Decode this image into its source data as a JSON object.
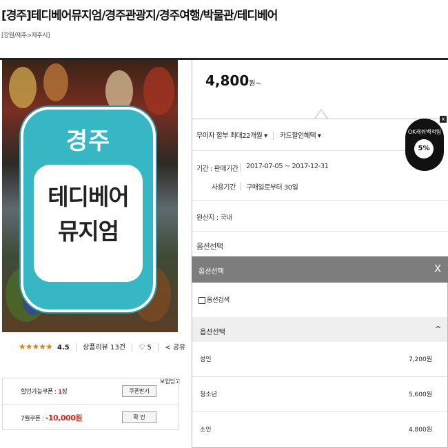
{
  "header": {
    "title": "[경주]테디베어뮤지엄/경주관광지/경주여행/박물관/테디베어",
    "breadcrumb": "[강원/제주>제주시]"
  },
  "hero": {
    "city": "경주",
    "line1": "테디베어",
    "line2": "뮤지엄"
  },
  "rating": {
    "stars": "★★★★★",
    "score": "4.5",
    "reviews_label": "상품리뷰 13건",
    "like_icon": "heart-icon",
    "likes": "5",
    "share_label": "공유"
  },
  "coupons": {
    "row1_label": "할인가능쿠폰 : ",
    "row1_count": "1",
    "row1_unit": "장",
    "row1_button": "쿠폰받기",
    "row2_label": "7월쿠폰 : ",
    "row2_value": "-10,000원",
    "row2_button": "확  인",
    "side_label": "보험담고"
  },
  "product": {
    "price": "4,800",
    "price_unit": "원~",
    "installment": "무이자 할부 최대22개월",
    "card_benefit": "카드할인혜택",
    "period_label": "기간 : 판매기간",
    "period_value": "2017-07-05 ~ 2017-12-31",
    "usage_label": "사용기간",
    "usage_value": "구매일로부터 30일",
    "origin": "원산지 : 국내",
    "option_select": "옵션선택"
  },
  "ok_badge": {
    "text": "OK캐쉬백적립",
    "percent": "5%",
    "close": "x"
  },
  "dropdown": {
    "header": "옵션선택",
    "close": "X",
    "search_label": "옵션검색",
    "sub_header": "옵션선택",
    "chevron": "^",
    "items": [
      {
        "name": "성인",
        "price": "7,200원"
      },
      {
        "name": "청소년",
        "price": "5,600원"
      },
      {
        "name": "소인",
        "price": "4,800원"
      }
    ]
  },
  "colors": {
    "accent_red": "#e0261a",
    "badge_teal": "#37b6c4",
    "header_gray": "#7d7d7d"
  }
}
